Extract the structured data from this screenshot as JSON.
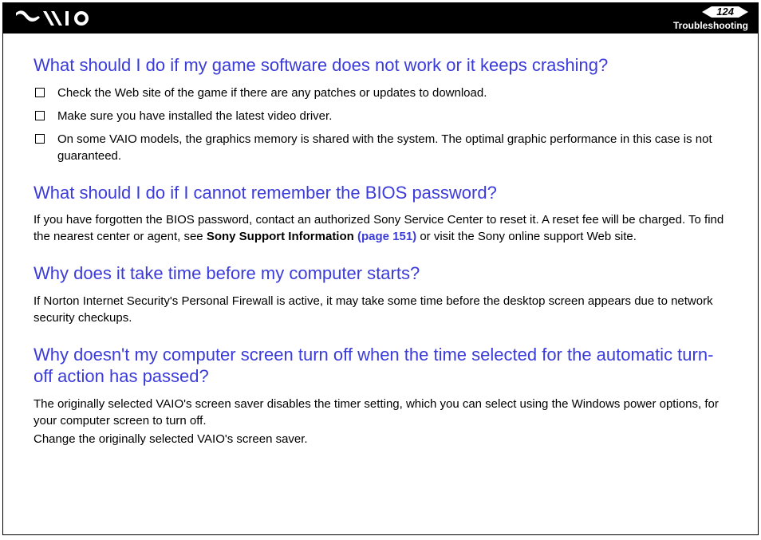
{
  "header": {
    "page_number": "124",
    "section": "Troubleshooting"
  },
  "q1": {
    "title": "What should I do if my game software does not work or it keeps crashing?",
    "items": [
      "Check the Web site of the game if there are any patches or updates to download.",
      "Make sure you have installed the latest video driver.",
      "On some VAIO models, the graphics memory is shared with the system. The optimal graphic performance in this case is not guaranteed."
    ]
  },
  "q2": {
    "title": "What should I do if I cannot remember the BIOS password?",
    "p1a": "If you have forgotten the BIOS password, contact an authorized Sony Service Center to reset it. A reset fee will be charged. To find the nearest center or agent, see ",
    "p1b_bold": "Sony Support Information ",
    "p1c_link": "(page 151)",
    "p1d": " or visit the Sony online support Web site."
  },
  "q3": {
    "title": "Why does it take time before my computer starts?",
    "p1": "If Norton Internet Security's Personal Firewall is active, it may take some time before the desktop screen appears due to network security checkups."
  },
  "q4": {
    "title": "Why doesn't my computer screen turn off when the time selected for the automatic turn-off action has passed?",
    "p1": "The originally selected VAIO's screen saver disables the timer setting, which you can select using the Windows power options, for your computer screen to turn off.",
    "p2": "Change the originally selected VAIO's screen saver."
  }
}
